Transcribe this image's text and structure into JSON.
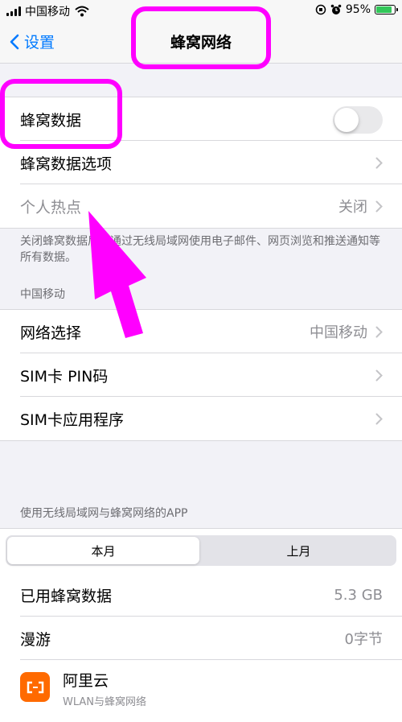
{
  "status_bar": {
    "carrier": "中国移动",
    "battery_percent": "95%",
    "battery_level": 0.95
  },
  "nav": {
    "back_label": "设置",
    "title": "蜂窝网络"
  },
  "cellular_group": {
    "cellular_data": {
      "label": "蜂窝数据",
      "enabled": false
    },
    "cellular_options": {
      "label": "蜂窝数据选项"
    },
    "hotspot": {
      "label": "个人热点",
      "value": "关闭"
    }
  },
  "cellular_note": "关闭蜂窝数据后，通过无线局域网使用电子邮件、网页浏览和推送通知等所有数据。",
  "carrier_header": "中国移动",
  "carrier_group": {
    "network_selection": {
      "label": "网络选择",
      "value": "中国移动"
    },
    "sim_pin": {
      "label": "SIM卡 PIN码"
    },
    "sim_apps": {
      "label": "SIM卡应用程序"
    }
  },
  "apps_header": "使用无线局域网与蜂窝网络的APP",
  "period_tabs": {
    "current": "本月",
    "previous": "上月"
  },
  "usage_group": {
    "used": {
      "label": "已用蜂窝数据",
      "value": "5.3 GB"
    },
    "roaming": {
      "label": "漫游",
      "value": "0字节"
    },
    "app": {
      "name": "阿里云",
      "subtitle": "WLAN与蜂窝网络"
    }
  },
  "colors": {
    "accent": "#007aff",
    "highlight": "#ff00ff",
    "app_icon": "#ff6a00"
  }
}
